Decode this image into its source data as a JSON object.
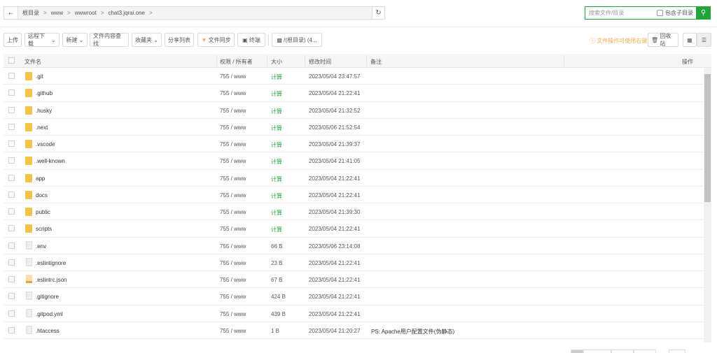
{
  "breadcrumb": [
    "根目录",
    "www",
    "wwwroot",
    "chat3.jqrai.one"
  ],
  "search": {
    "placeholder": "搜索文件/目录",
    "subdir_label": "包含子目录"
  },
  "toolbar": {
    "upload": "上传",
    "remote_download": "远程下载",
    "new": "新建",
    "content_search": "文件内容查找",
    "favorites": "收藏夹",
    "share_list": "分享列表",
    "file_sync": "文件同步",
    "terminal": "终端",
    "disk": "/(根目录) (4...",
    "tip": "文件操作可使用右键",
    "recycle": "回收站"
  },
  "columns": {
    "name": "文件名",
    "perm": "权限 / 所有者",
    "size": "大小",
    "mtime": "修改时间",
    "remark": "备注",
    "actions": "操作"
  },
  "rows": [
    {
      "name": ".git",
      "type": "folder",
      "perm": "755 / www",
      "size": "计算",
      "mtime": "2023/05/04 23:47:57",
      "remark": ""
    },
    {
      "name": ".github",
      "type": "folder",
      "perm": "755 / www",
      "size": "计算",
      "mtime": "2023/05/04 21:22:41",
      "remark": ""
    },
    {
      "name": ".husky",
      "type": "folder",
      "perm": "755 / www",
      "size": "计算",
      "mtime": "2023/05/04 21:32:52",
      "remark": ""
    },
    {
      "name": ".next",
      "type": "folder",
      "perm": "755 / www",
      "size": "计算",
      "mtime": "2023/05/06 21:52:54",
      "remark": ""
    },
    {
      "name": ".vscode",
      "type": "folder",
      "perm": "755 / www",
      "size": "计算",
      "mtime": "2023/05/04 21:39:37",
      "remark": ""
    },
    {
      "name": ".well-known",
      "type": "folder",
      "perm": "755 / www",
      "size": "计算",
      "mtime": "2023/05/04 21:41:05",
      "remark": ""
    },
    {
      "name": "app",
      "type": "folder",
      "perm": "755 / www",
      "size": "计算",
      "mtime": "2023/05/04 21:22:41",
      "remark": ""
    },
    {
      "name": "docs",
      "type": "folder",
      "perm": "755 / www",
      "size": "计算",
      "mtime": "2023/05/04 21:22:41",
      "remark": ""
    },
    {
      "name": "public",
      "type": "folder",
      "perm": "755 / www",
      "size": "计算",
      "mtime": "2023/05/04 21:39:30",
      "remark": ""
    },
    {
      "name": "scripts",
      "type": "folder",
      "perm": "755 / www",
      "size": "计算",
      "mtime": "2023/05/04 21:22:41",
      "remark": ""
    },
    {
      "name": ".env",
      "type": "file",
      "perm": "755 / www",
      "size": "66 B",
      "mtime": "2023/05/06 23:14:08",
      "remark": ""
    },
    {
      "name": ".eslintignore",
      "type": "file",
      "perm": "755 / www",
      "size": "23 B",
      "mtime": "2023/05/04 21:22:41",
      "remark": ""
    },
    {
      "name": ".eslintrc.json",
      "type": "json",
      "perm": "755 / www",
      "size": "67 B",
      "mtime": "2023/05/04 21:22:41",
      "remark": ""
    },
    {
      "name": ".gitignore",
      "type": "file",
      "perm": "755 / www",
      "size": "424 B",
      "mtime": "2023/05/04 21:22:41",
      "remark": ""
    },
    {
      "name": ".gitpod.yml",
      "type": "file",
      "perm": "755 / www",
      "size": "439 B",
      "mtime": "2023/05/04 21:22:41",
      "remark": ""
    },
    {
      "name": ".htaccess",
      "type": "file",
      "perm": "755 / www",
      "size": "1 B",
      "mtime": "2023/05/04 21:20:27",
      "remark": "PS: Apache用户配置文件(伪静态)"
    }
  ]
}
